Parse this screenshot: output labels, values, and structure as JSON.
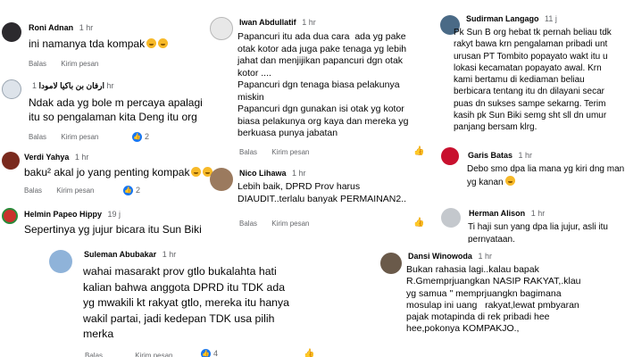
{
  "ui": {
    "reply_label": "Balas",
    "send_label": "Kirim pesan",
    "like_glyph": "👍"
  },
  "comments": [
    {
      "author": "Roni Adnan",
      "time": "1 hr",
      "lines": [
        "ini namanya tda kompak"
      ],
      "emoji": [
        "laughing-tears",
        "grin"
      ],
      "likes": ""
    },
    {
      "author": "ارفان بن باكيا لامودا",
      "time": "1 hr",
      "lines": [
        "Ndak ada yg bole m percaya apalagi",
        "itu so pengalaman kita Deng itu org"
      ],
      "likes": "2"
    },
    {
      "author": "Verdi Yahya",
      "time": "1 hr",
      "lines": [
        "baku² akal jo yang penting kompak"
      ],
      "emoji": [
        "laughing-tears",
        "laughing-tears"
      ],
      "likes": "2"
    },
    {
      "author": "Helmin Papeo Hippy",
      "time": "19 j",
      "lines": [
        "Sepertinya yg jujur bicara itu Sun Biki"
      ],
      "likes": ""
    },
    {
      "author": "Iwan Abdullatif",
      "time": "1 hr",
      "lines": [
        "Papancuri itu ada dua cara  ada yg pake",
        "otak kotor ada juga pake tenaga yg lebih",
        "jahat dan menjijikan papancuri dgn otak",
        "kotor ....",
        "Papancuri dgn tenaga biasa pelakunya",
        "miskin",
        "Papancuri dgn gunakan isi otak yg kotor",
        "biasa pelakunya org kaya dan mereka yg",
        "berkuasa punya jabatan"
      ],
      "likes": ""
    },
    {
      "author": "Nico Lihawa",
      "time": "1 hr",
      "lines": [
        "Lebih baik, DPRD Prov harus",
        "DIAUDIT..terlalu banyak PERMAINAN2.."
      ],
      "likes": ""
    },
    {
      "author": "Sudirman Langago",
      "time": "11 j",
      "lines": [
        "Pk Sun B org hebat tk pernah beliau tdk",
        "rakyt bawa krn pengalaman pribadi unt",
        "urusan PT Tombito popayato wakt itu u",
        "lokasi kecamatan popayato awal. Krn",
        "kami bertamu di kediaman beliau",
        "berbicara tentang itu dn dilayani secar",
        "puas dn sukses sampe sekarng. Terim",
        "kasih pk Sun Biki semg sht sll dn umur",
        "panjang bersam klrg."
      ],
      "likes": ""
    },
    {
      "author": "Garis Batas",
      "time": "1 hr",
      "lines": [
        "Debo smo dpa lia mana yg kiri dng man",
        "yg kanan"
      ],
      "emoji": [
        "laughing-tears"
      ],
      "likes": ""
    },
    {
      "author": "Herman Alison",
      "time": "1 hr",
      "lines": [
        "Ti haji sun yang dpa lia jujur, asli itu",
        "pernyataan."
      ],
      "likes": ""
    },
    {
      "author": "Suleman Abubakar",
      "time": "1 hr",
      "lines": [
        "wahai masarakt prov gtlo bukalahta hati",
        "kalian bahwa anggota DPRD itu TDK ada",
        "yg mwakili kt rakyat gtlo, mereka itu hanya",
        "wakil partai, jadi kedepan TDK usa pilih",
        "merka"
      ],
      "likes": "4"
    },
    {
      "author": "Dansi Winowoda",
      "time": "1 hr",
      "lines": [
        "Bukan rahasia lagi..kalau bapak",
        "R.Gmemprjuangkan NASIP RAKYAT,.klau",
        "yg samua \" memprjuangkn bagimana",
        "mosulap ini uang   rakyat,lewat pmbyaran",
        "pajak motapinda di rek pribadi hee",
        "hee,pokonya KOMPAKJO.,"
      ],
      "likes": ""
    }
  ]
}
